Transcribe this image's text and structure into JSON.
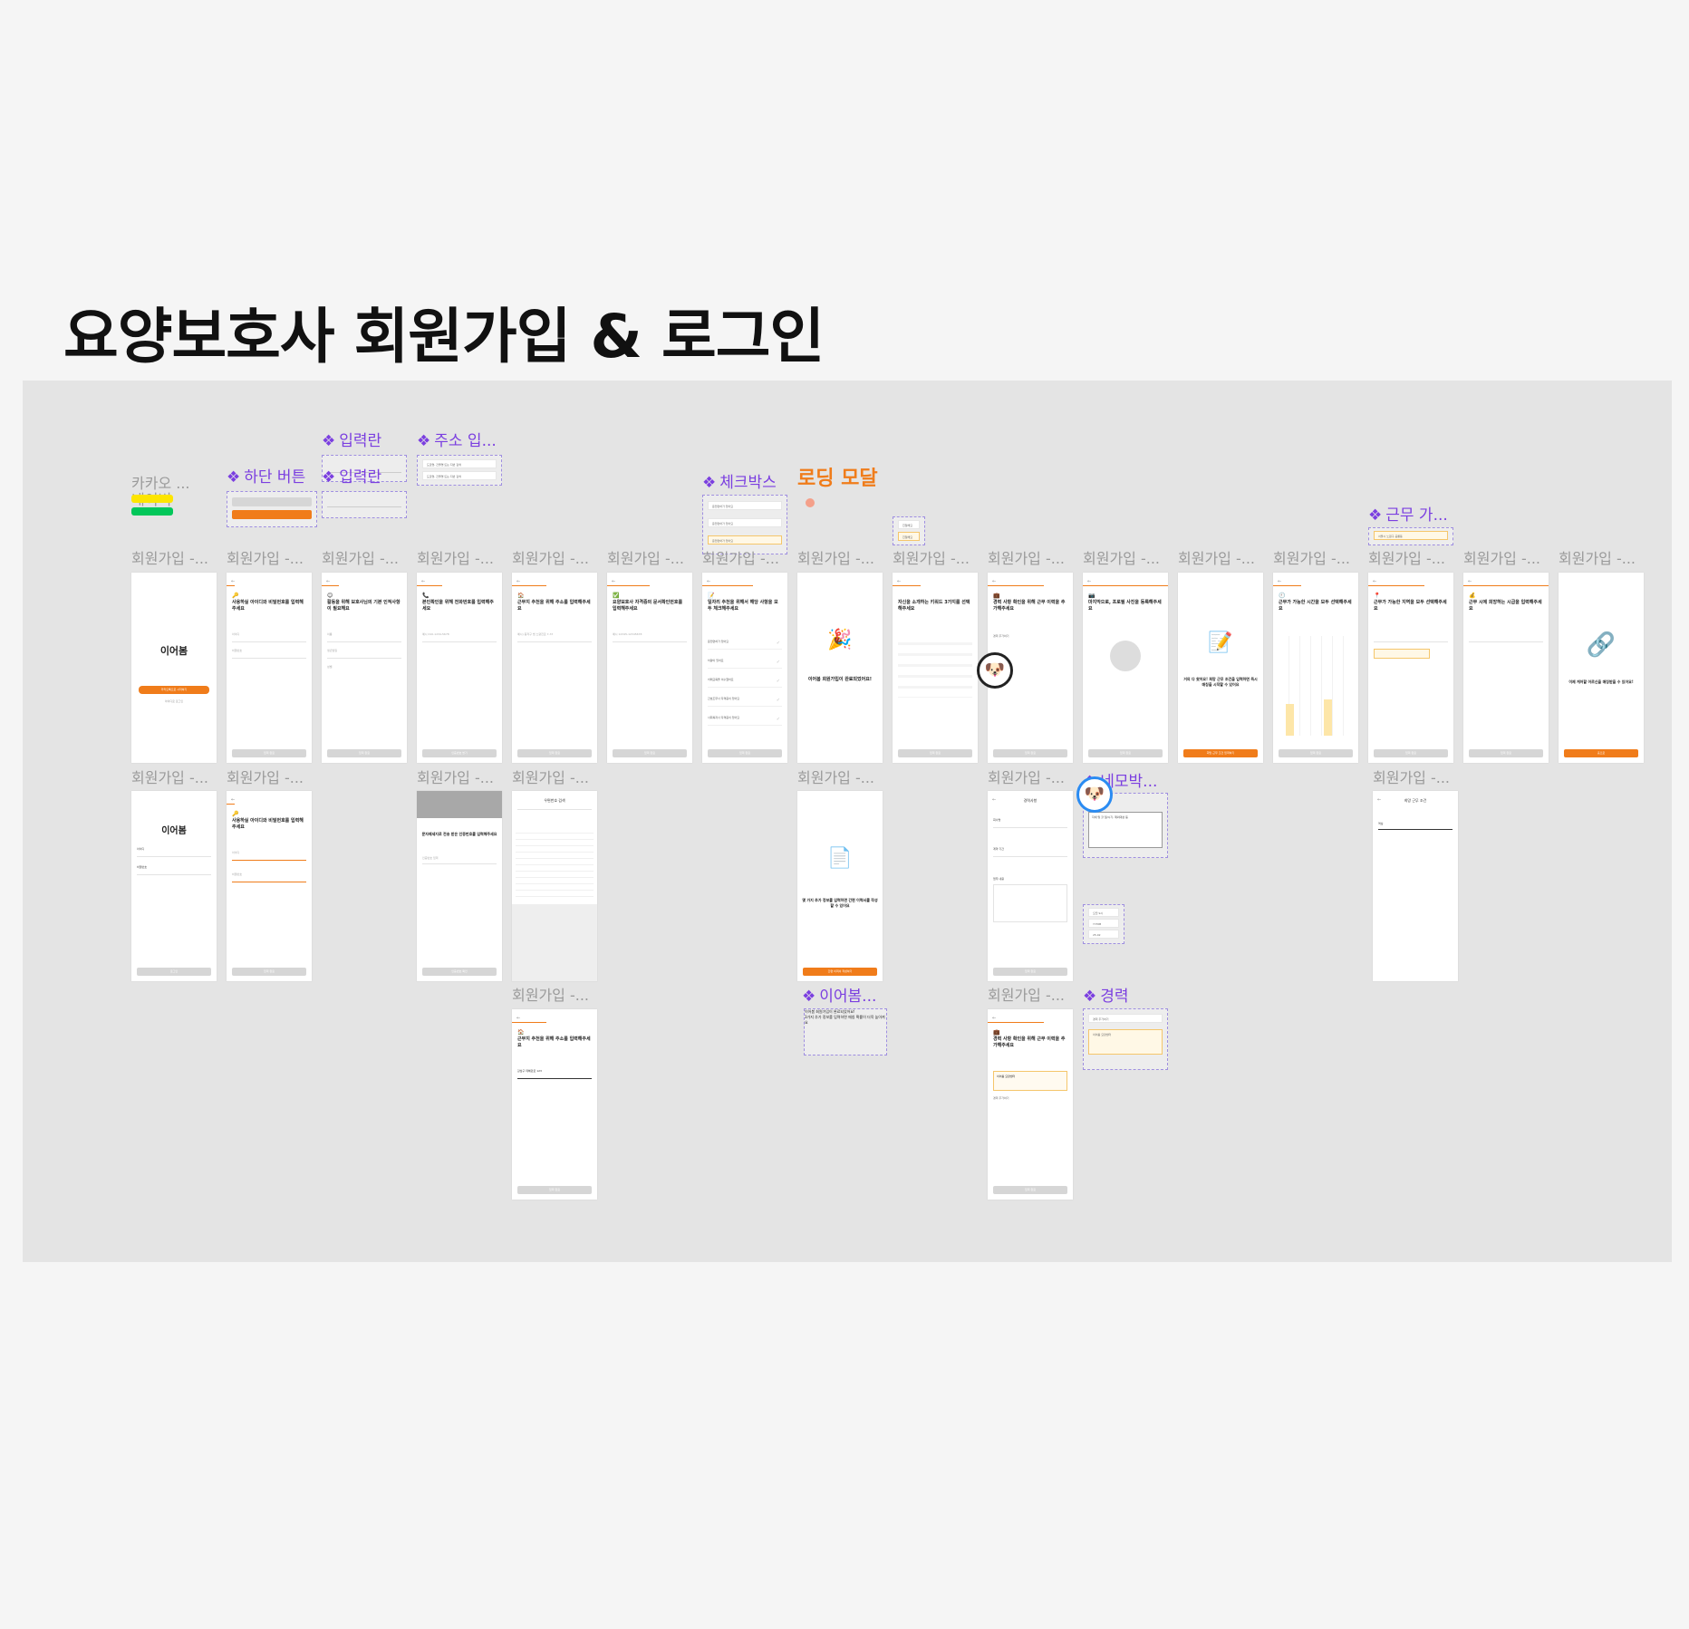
{
  "page_title": "요양보호사 회원가입 & 로그인",
  "frame_label": "회원가입 -...",
  "components": {
    "kakao": "카카오 ...",
    "naver": "네이버",
    "bottom_button": "하단 버튼",
    "input1": "입력란",
    "input2": "입력란",
    "address": "주소 입...",
    "checkbox": "체크박스",
    "loading_modal": "로딩 모달",
    "work_avail": "근무 가...",
    "nemo": "네모박...",
    "ieobom": "이어봄...",
    "career": "경력"
  },
  "screens": {
    "r1c1": {
      "brand": "이어봄",
      "btn": "카카오톡으로 시작하기",
      "sub": "아이디로 로그인"
    },
    "r1c2": {
      "q": "사용하실 아이디와 비밀번호를 입력해주세요",
      "f1": "아이디",
      "f2": "비밀번호",
      "btn": "입력 완료"
    },
    "r1c3": {
      "q": "활동을 위해 보호사님의 기본 인적사항이 필요해요",
      "f1": "이름",
      "f2": "생년월일",
      "f3": "성별",
      "btn": "입력 완료"
    },
    "r1c4": {
      "q": "본인확인을 위해 전화번호를 입력해주세요",
      "f1": "예시 010-1234-5678",
      "btn": "인증번호 받기"
    },
    "r1c5": {
      "q": "근무지 추천을 위해 주소를 입력해주세요",
      "f1": "예시) 동작구 법 노량진로 7-37",
      "btn": "입력 완료"
    },
    "r1c6": {
      "q": "요양보호사 자격증의 문서확인번호를 입력해주세요",
      "f1": "예시 12345-12345678",
      "btn": "입력 완료"
    },
    "r1c7": {
      "q": "일자리 추천을 위해서 해당 사항을 모두 체크해주세요",
      "items": [
        "운전면허가 있어요",
        "차량이 있어요",
        "치매교육을 이수했어요",
        "간호조무사 자격증이 있어요",
        "사회복지사 자격증이 있어요"
      ],
      "btn": "입력 완료"
    },
    "r1c8": {
      "msg": "이어봄 회원가입이 완료되었어요!"
    },
    "r1c9": {
      "q": "자신을 소개하는 키워드 3가지를 선택해주세요",
      "btn": "입력 완료"
    },
    "r1c10": {
      "q": "경력 사항 확인을 위해 근무 이력을 추가해주세요",
      "add": "경력 추가하기",
      "btn": "입력 완료"
    },
    "r1c11": {
      "q": "마지막으로, 프로필 사진을 등록해주세요",
      "btn": "입력 완료"
    },
    "r1c12": {
      "msg": "거의 다 왔어요! 희망 근무 조건을 입력하면 즉시 매칭을 시작할 수 있어요",
      "btn": "희망 근무 조건 입력하기"
    },
    "r1c13": {
      "q": "근무가 가능한 시간을 모두 선택해주세요",
      "btn": "입력 완료"
    },
    "r1c14": {
      "q": "근무가 가능한 지역을 모두 선택해주세요",
      "btn": "입력 완료"
    },
    "r1c15": {
      "q": "근무 시에 희망하는 시급을 입력해주세요",
      "btn": "입력 완료"
    },
    "r1c16": {
      "msg": "이제 케어할 어르신을 매칭받을 수 있어요!",
      "btn": "홈으로"
    },
    "r2c1": {
      "brand": "이어봄",
      "f1": "아이디",
      "f2": "비밀번호",
      "btn": "로그인"
    },
    "r2c2": {
      "q": "사용하실 아이디와 비밀번호를 입력해주세요",
      "f1": "아이디",
      "f2": "비밀번호",
      "btn": "입력 완료"
    },
    "r2c4": {
      "q": "문자메세지로 전송 받은 인증번호를 입력해주세요",
      "f1": "인증번호 입력",
      "btn": "인증번호 확인"
    },
    "r2c5": {
      "q": "우편번호 검색",
      "btn": ""
    },
    "r2c8": {
      "msg": "몇 가지 추가 정보를 입력하면 간편 이력서를 작성할 수 있어요",
      "btn": "간편 이력서 작성하기"
    },
    "r2c10": {
      "q": "경력사항",
      "f1": "회사명",
      "f2": "계약 기간",
      "f3": "업무 내용",
      "btn": "입력 완료"
    },
    "r2c14": {
      "q": "희망 근무 조건",
      "f1": "역삼",
      "btn": ""
    },
    "r3c5": {
      "q": "근무지 추천을 위해 주소를 입력해주세요",
      "f1": "강남구 테헤란로 123",
      "btn": "입력 완료"
    },
    "r3c10": {
      "q": "경력 사항 확인을 위해 근무 이력을 추가해주세요",
      "card": "이어봄 요양센터",
      "add": "경력 추가하기",
      "btn": "입력 완료"
    }
  },
  "modal_text": {
    "l1": "이어봄 회원가입이 완료되었어요!",
    "l2": "3가지 추가 정보를 입력하면 매칭 확률이 더욱 높아져요"
  },
  "checkbox_items": [
    "운전면허가 있어요",
    "운전면허가 있어요",
    "운전면허가 있어요"
  ],
  "address_items": [
    "도로명, 건물명 또는 지번 검색",
    "도로명, 건물명 또는 지번 검색"
  ],
  "work_item": "서울시 노원구 공릉동",
  "career_items": [
    "경력 추가하기",
    "이어봄 요양센터"
  ],
  "nemo_text": "자세 및 할 일/시기, 제외대상 등",
  "time_items": [
    "오전 9시",
    "YY.MM",
    "25.02"
  ],
  "tags": [
    "친절해요",
    "친절해요"
  ]
}
